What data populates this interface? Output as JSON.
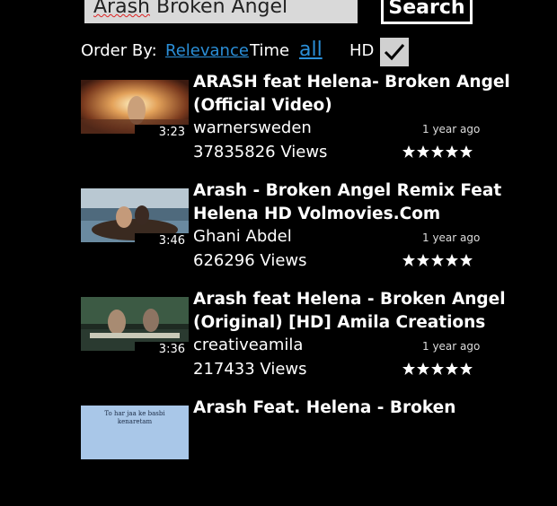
{
  "search": {
    "query_word1": "Arash",
    "query_rest": " Broken Angel",
    "button_label": "Search"
  },
  "order": {
    "label": "Order By:",
    "relevance": "Relevance",
    "time_label": "Time",
    "all": "all",
    "hd_label": "HD",
    "hd_checked": true
  },
  "results": [
    {
      "title": "ARASH feat Helena- Broken Angel (Official Video)",
      "channel": "warnersweden",
      "age": "1 year ago",
      "views": "37835826 Views",
      "duration": "3:23",
      "rating": 5
    },
    {
      "title": "Arash - Broken Angel Remix Feat Helena HD Volmovies.Com",
      "channel": "Ghani Abdel",
      "age": "1 year ago",
      "views": "626296 Views",
      "duration": "3:46",
      "rating": 5
    },
    {
      "title": "Arash feat Helena - Broken Angel (Original) [HD] Amila Creations",
      "channel": "creativeamila",
      "age": "1 year ago",
      "views": "217433 Views",
      "duration": "3:36",
      "rating": 5
    },
    {
      "title": "Arash Feat. Helena - Broken",
      "thumb_caption_1": "To har jaa ke basbi",
      "thumb_caption_2": "kenaretam"
    }
  ],
  "colors": {
    "accent": "#2b8fd8",
    "background": "#000000",
    "search_bg": "#d9d9d9"
  }
}
